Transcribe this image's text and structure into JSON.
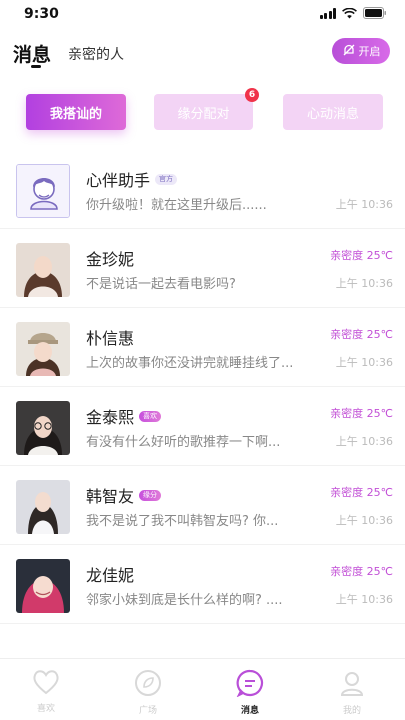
{
  "status_bar": {
    "time": "9:30"
  },
  "header": {
    "tab_messages": "消息",
    "tab_intimate": "亲密的人",
    "open_button_label": "开启"
  },
  "segments": {
    "active": "我搭讪的",
    "match": "缘分配对",
    "match_badge": "6",
    "heart": "心动消息"
  },
  "messages": [
    {
      "name": "心伴助手",
      "tag": "官方",
      "preview": "你升级啦！就在这里升级后......",
      "intimacy": "",
      "time": "上午 10:36"
    },
    {
      "name": "金珍妮",
      "tag": "",
      "preview": "不是说话一起去看电影吗?",
      "intimacy": "亲密度 25℃",
      "time": "上午 10:36"
    },
    {
      "name": "朴信惠",
      "tag": "",
      "preview": "上次的故事你还没讲完就睡挂线了...",
      "intimacy": "亲密度 25℃",
      "time": "上午 10:36"
    },
    {
      "name": "金泰熙",
      "tag": "喜欢",
      "preview": "有没有什么好听的歌推荐一下啊...",
      "intimacy": "亲密度 25℃",
      "time": "上午 10:36"
    },
    {
      "name": "韩智友",
      "tag": "缘分",
      "preview": "我不是说了我不叫韩智友吗? 你...",
      "intimacy": "亲密度 25℃",
      "time": "上午 10:36"
    },
    {
      "name": "龙佳妮",
      "tag": "",
      "preview": "邻家小妹到底是长什么样的啊? ....",
      "intimacy": "亲密度 25℃",
      "time": "上午 10:36"
    }
  ],
  "bottom_nav": {
    "like": "喜欢",
    "plaza": "广场",
    "messages": "消息",
    "mine": "我的"
  },
  "colors": {
    "accent": "#c24fd6",
    "accent_light": "#f3d4f5",
    "badge": "#f0334a"
  },
  "icons": [
    "signal-icon",
    "wifi-icon",
    "battery-icon",
    "bell-off-icon",
    "heart-icon",
    "compass-icon",
    "chat-icon",
    "user-icon"
  ]
}
